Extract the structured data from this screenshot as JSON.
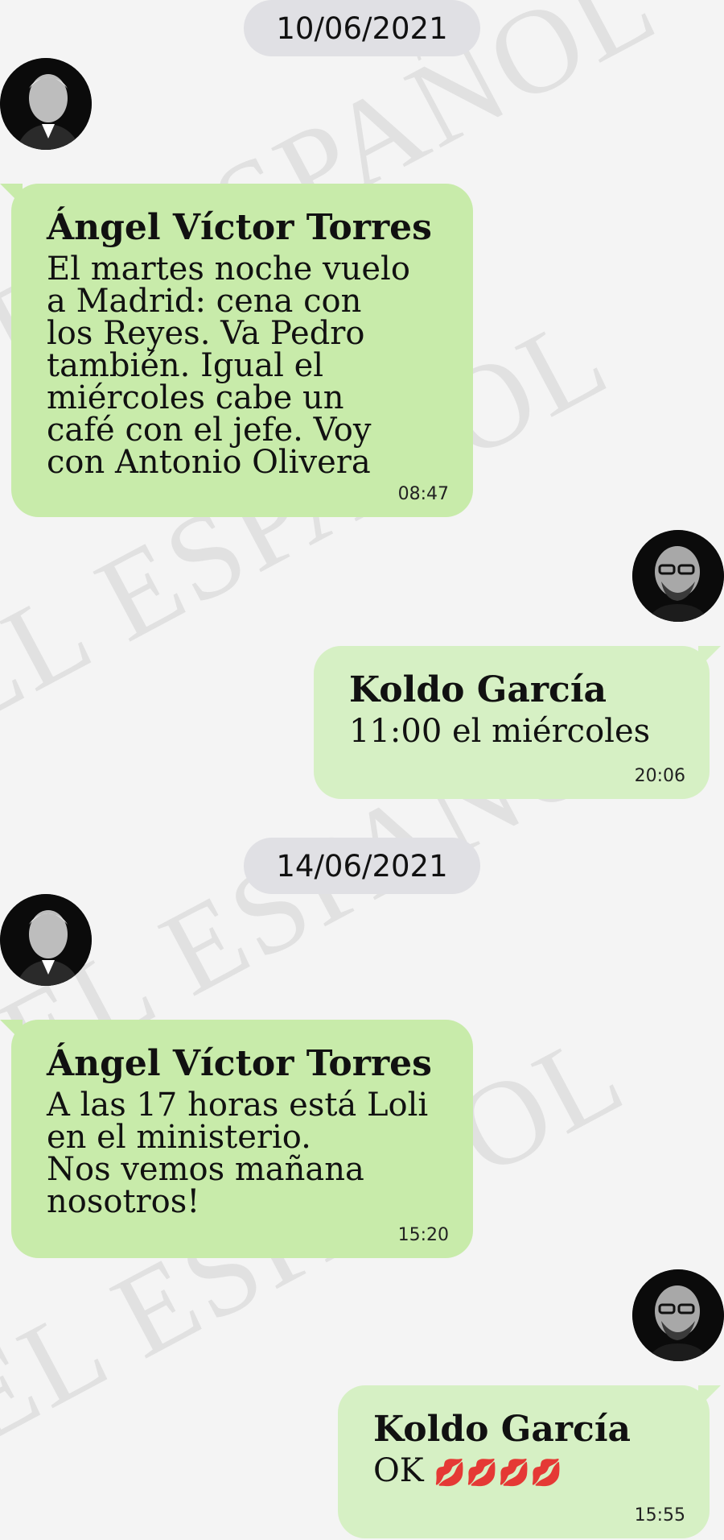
{
  "watermark": "EL ESPAÑOL",
  "colors": {
    "incoming_bubble": "#c8ebaa",
    "outgoing_bubble": "#d6f0c4",
    "date_pill": "#e0e0e4"
  },
  "dates": [
    "10/06/2021",
    "14/06/2021"
  ],
  "messages": [
    {
      "sender": "Ángel Víctor Torres",
      "text": "El martes noche vuelo\na Madrid: cena con\nlos Reyes. Va Pedro\ntambién. Igual el\nmiércoles cabe un\ncafé con el jefe. Voy\ncon Antonio Olivera",
      "time": "08:47"
    },
    {
      "sender": "Koldo García",
      "text": "11:00 el miércoles",
      "time": "20:06"
    },
    {
      "sender": "Ángel Víctor Torres",
      "text": "A las 17 horas está Loli\nen el ministerio.\nNos vemos mañana\nnosotros!",
      "time": "15:20"
    },
    {
      "sender": "Koldo García",
      "text": "OK",
      "emoji": "💋💋💋💋",
      "time": "15:55"
    }
  ],
  "avatars": [
    "avatar-angel-victor-torres",
    "avatar-koldo-garcia"
  ]
}
